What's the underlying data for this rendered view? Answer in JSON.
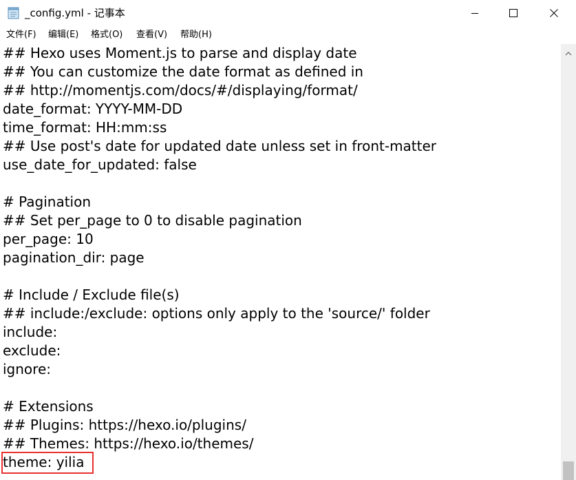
{
  "window": {
    "title": "_config.yml - 记事本"
  },
  "menu": {
    "items": [
      "文件(F)",
      "编辑(E)",
      "格式(O)",
      "查看(V)",
      "帮助(H)"
    ]
  },
  "editor": {
    "lines": [
      "## Hexo uses Moment.js to parse and display date",
      "## You can customize the date format as defined in",
      "## http://momentjs.com/docs/#/displaying/format/",
      "date_format: YYYY-MM-DD",
      "time_format: HH:mm:ss",
      "## Use post's date for updated date unless set in front-matter",
      "use_date_for_updated: false",
      "",
      "# Pagination",
      "## Set per_page to 0 to disable pagination",
      "per_page: 10",
      "pagination_dir: page",
      "",
      "# Include / Exclude file(s)",
      "## include:/exclude: options only apply to the 'source/' folder",
      "include:",
      "exclude:",
      "ignore:",
      "",
      "# Extensions",
      "## Plugins: https://hexo.io/plugins/",
      "## Themes: https://hexo.io/themes/",
      "theme: yilia"
    ]
  },
  "colors": {
    "highlight_border": "#e8312f",
    "scrollbar_track": "#f0f0f0",
    "scrollbar_thumb": "#c2c2c2"
  },
  "icons": {
    "app": "notepad-icon",
    "minimize": "minimize-icon",
    "maximize": "maximize-icon",
    "close": "close-icon",
    "scroll_up": "chevron-up-icon"
  }
}
